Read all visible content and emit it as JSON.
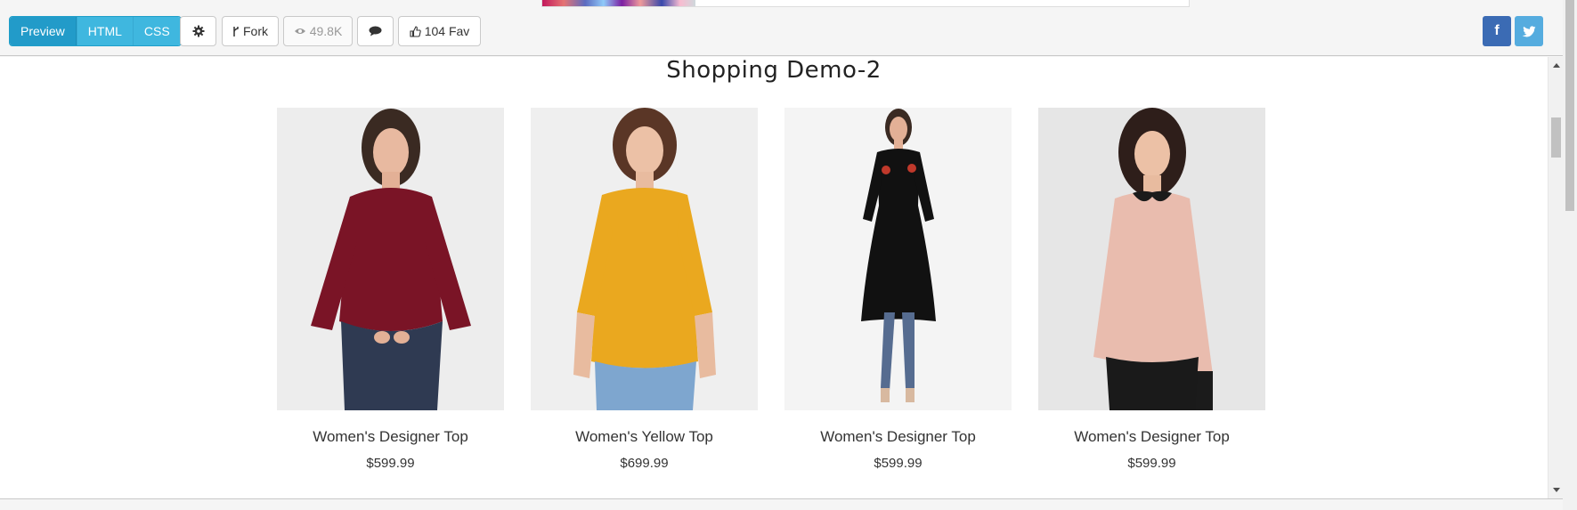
{
  "toolbar": {
    "tabs": [
      {
        "label": "Preview",
        "active": true
      },
      {
        "label": "HTML",
        "active": false
      },
      {
        "label": "CSS",
        "active": false
      }
    ],
    "settings_icon": "gear-icon",
    "fork_label": "Fork",
    "views_count": "49.8K",
    "comment_icon": "comment-icon",
    "fav_label": "104 Fav",
    "facebook_label": "f",
    "colors": {
      "accent": "#3fb7df",
      "accent_active": "#229bc9",
      "facebook": "#3b6bb4",
      "twitter": "#55acdf"
    }
  },
  "preview": {
    "title": "Shopping Demo-2",
    "products": [
      {
        "name": "Women's Designer Top",
        "price": "$599.99",
        "top_color": "#7a1426",
        "bg": "#ededed"
      },
      {
        "name": "Women's Yellow Top",
        "price": "$699.99",
        "top_color": "#eaa81f",
        "bg": "#efefef"
      },
      {
        "name": "Women's Designer Top",
        "price": "$599.99",
        "top_color": "#111111",
        "bg": "#f4f4f4"
      },
      {
        "name": "Women's Designer Top",
        "price": "$599.99",
        "top_color": "#e9bcae",
        "bg": "#e6e6e6"
      }
    ]
  }
}
